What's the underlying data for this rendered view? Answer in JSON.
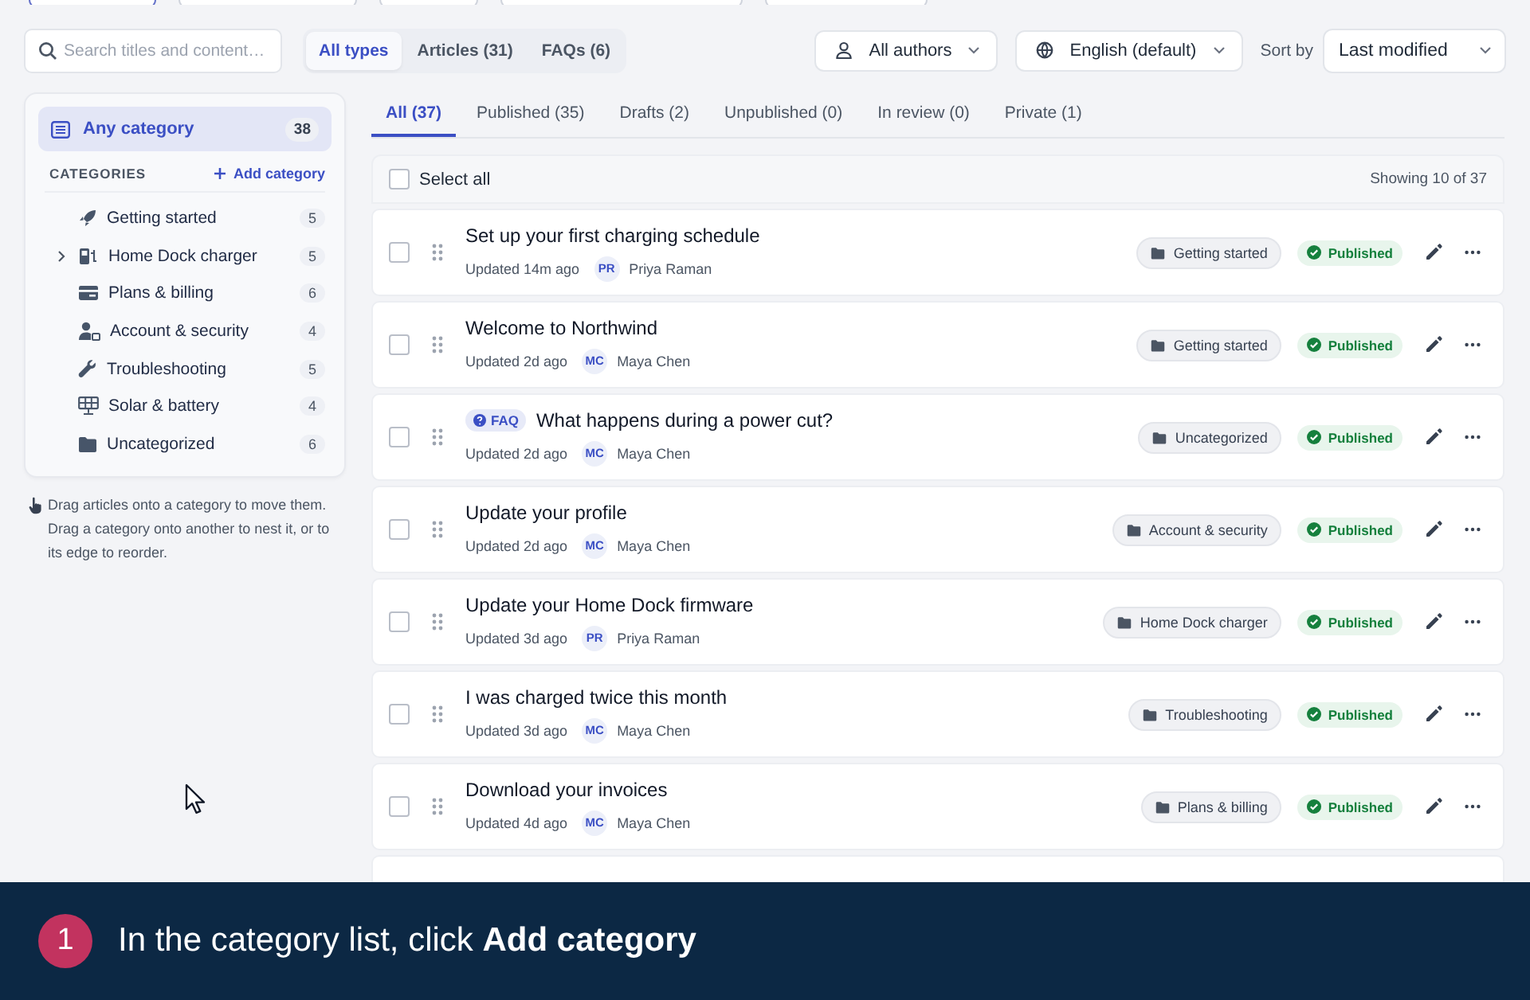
{
  "search": {
    "placeholder": "Search titles and content…"
  },
  "type_filter": [
    {
      "label": "All types",
      "selected": true
    },
    {
      "label": "Articles (31)",
      "selected": false
    },
    {
      "label": "FAQs (6)",
      "selected": false
    }
  ],
  "filters": [
    {
      "label": "All authors",
      "kind": "author"
    },
    {
      "label": "English (default)",
      "kind": "language"
    }
  ],
  "sort": {
    "label": "Sort by",
    "value": "Last modified"
  },
  "sidebar": {
    "any_category": {
      "label": "Any category",
      "count": "38",
      "selected": true
    },
    "heading": "CATEGORIES",
    "add_button": "Add category",
    "categories": [
      {
        "label": "Getting started",
        "count": "5",
        "expandable": false
      },
      {
        "label": "Home Dock charger",
        "count": "5",
        "expandable": true
      },
      {
        "label": "Plans & billing",
        "count": "6",
        "expandable": false
      },
      {
        "label": "Account & security",
        "count": "4",
        "expandable": false
      },
      {
        "label": "Troubleshooting",
        "count": "5",
        "expandable": false
      },
      {
        "label": "Solar & battery",
        "count": "4",
        "expandable": false
      },
      {
        "label": "Uncategorized",
        "count": "6",
        "expandable": false
      }
    ],
    "hint": "Drag articles onto a category to move them. Drag a category onto another to nest it, or to its edge to reorder."
  },
  "status_tabs": [
    {
      "label": "All (37)",
      "selected": true
    },
    {
      "label": "Published (35)",
      "selected": false
    },
    {
      "label": "Drafts (2)",
      "selected": false
    },
    {
      "label": "Unpublished (0)",
      "selected": false
    },
    {
      "label": "In review (0)",
      "selected": false
    },
    {
      "label": "Private (1)",
      "selected": false
    }
  ],
  "list": {
    "select_all": "Select all",
    "select_all_checked": false,
    "showing": "Showing 10 of 37",
    "rows": [
      {
        "kind": "article",
        "title": "Set up your first charging schedule",
        "updated": "Updated 14m ago",
        "initials": "PR",
        "author": "Priya Raman",
        "category": "Getting started",
        "status": "Published",
        "checked": false
      },
      {
        "kind": "article",
        "title": "Welcome to Northwind",
        "updated": "Updated 2d ago",
        "initials": "MC",
        "author": "Maya Chen",
        "category": "Getting started",
        "status": "Published",
        "checked": false
      },
      {
        "kind": "faq",
        "badge": "FAQ",
        "title": "What happens during a power cut?",
        "updated": "Updated 2d ago",
        "initials": "MC",
        "author": "Maya Chen",
        "category": "Uncategorized",
        "status": "Published",
        "checked": false
      },
      {
        "kind": "article",
        "title": "Update your profile",
        "updated": "Updated 2d ago",
        "initials": "MC",
        "author": "Maya Chen",
        "category": "Account & security",
        "status": "Published",
        "checked": false
      },
      {
        "kind": "article",
        "title": "Update your Home Dock firmware",
        "updated": "Updated 3d ago",
        "initials": "PR",
        "author": "Priya Raman",
        "category": "Home Dock charger",
        "status": "Published",
        "checked": false
      },
      {
        "kind": "article",
        "title": "I was charged twice this month",
        "updated": "Updated 3d ago",
        "initials": "MC",
        "author": "Maya Chen",
        "category": "Troubleshooting",
        "status": "Published",
        "checked": false
      },
      {
        "kind": "article",
        "title": "Download your invoices",
        "updated": "Updated 4d ago",
        "initials": "MC",
        "author": "Maya Chen",
        "category": "Plans & billing",
        "status": "Published",
        "checked": false
      }
    ]
  },
  "callout": {
    "step": "1",
    "text": "In the category list, click **Add category**"
  }
}
